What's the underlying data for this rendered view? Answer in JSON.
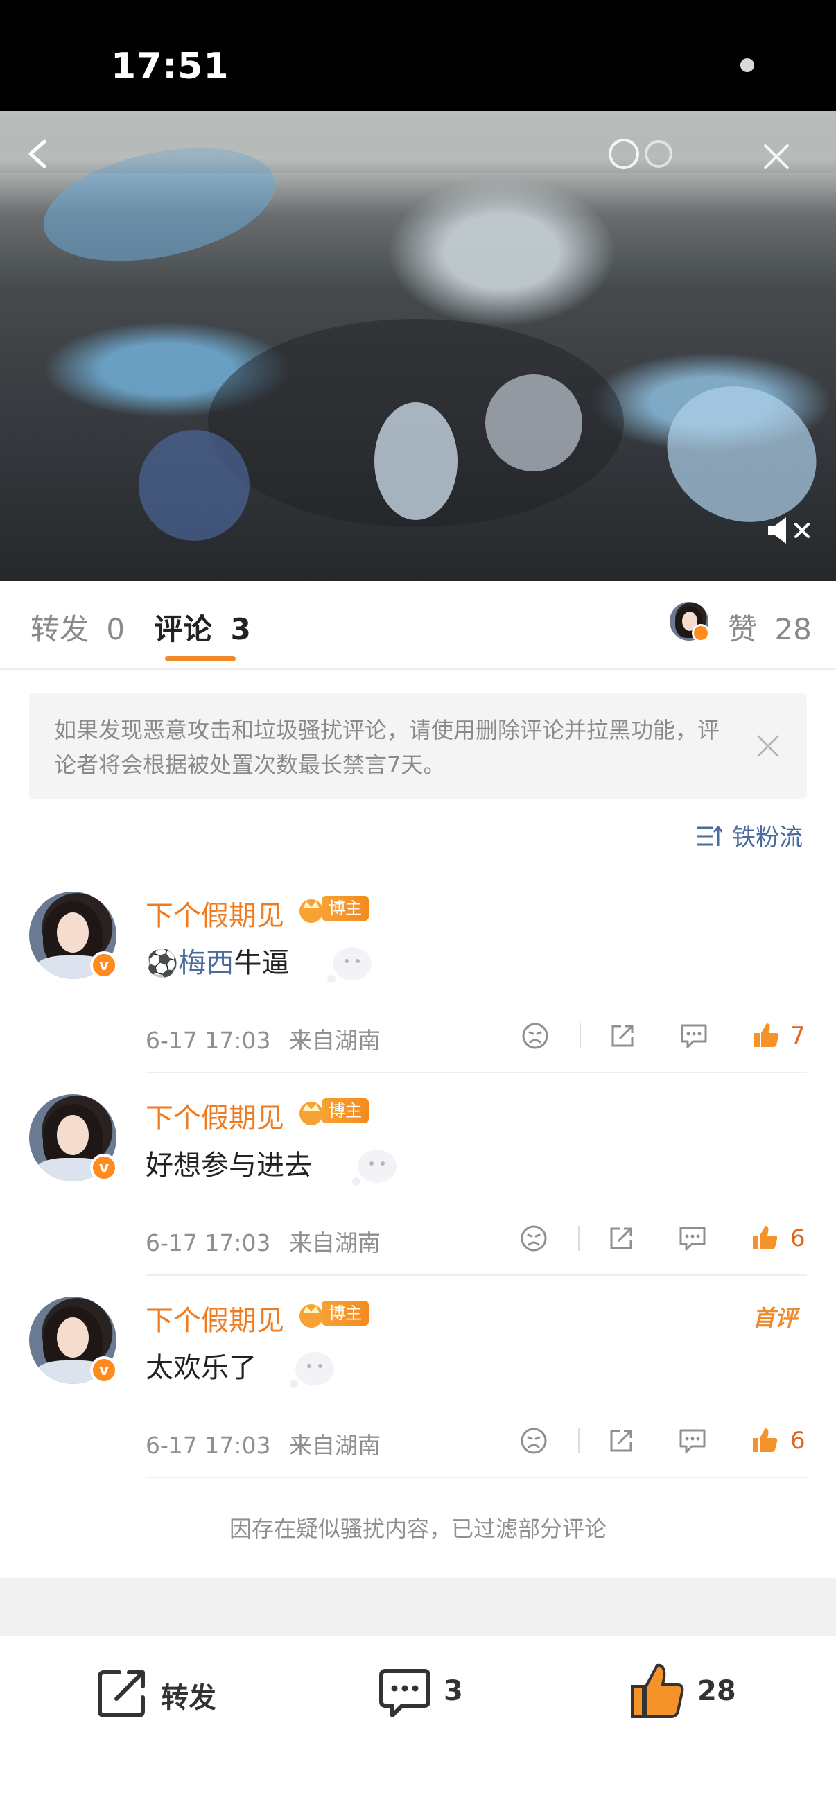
{
  "status_bar": {
    "time": "17:51"
  },
  "tabs": [
    {
      "label": "转发",
      "count": "0"
    },
    {
      "label": "评论",
      "count": "3"
    }
  ],
  "likes": {
    "label": "赞",
    "count": "28"
  },
  "notice": {
    "text": "如果发现恶意攻击和垃圾骚扰评论，请使用删除评论并拉黑功能，评论者将会根据被处置次数最长禁言7天。"
  },
  "sort": {
    "label": "铁粉流"
  },
  "comments": [
    {
      "username": "下个假期见",
      "badge": "博主",
      "emoji_text": "梅西",
      "text": "牛逼",
      "time": "6-17 17:03",
      "location": "来自湖南",
      "likes": "7",
      "first_comment": ""
    },
    {
      "username": "下个假期见",
      "badge": "博主",
      "emoji_text": "",
      "text": "好想参与进去",
      "time": "6-17 17:03",
      "location": "来自湖南",
      "likes": "6",
      "first_comment": ""
    },
    {
      "username": "下个假期见",
      "badge": "博主",
      "emoji_text": "",
      "text": "太欢乐了",
      "time": "6-17 17:03",
      "location": "来自湖南",
      "likes": "6",
      "first_comment": "首评"
    }
  ],
  "filter_note": "因存在疑似骚扰内容，已过滤部分评论",
  "bottom_bar": {
    "repost_label": "转发",
    "comment_count": "3",
    "like_count": "28"
  },
  "icons": {
    "verified": "v-badge-icon",
    "accent": "#f07a1e",
    "link": "#4a6b9e",
    "like": "#f5922a"
  }
}
